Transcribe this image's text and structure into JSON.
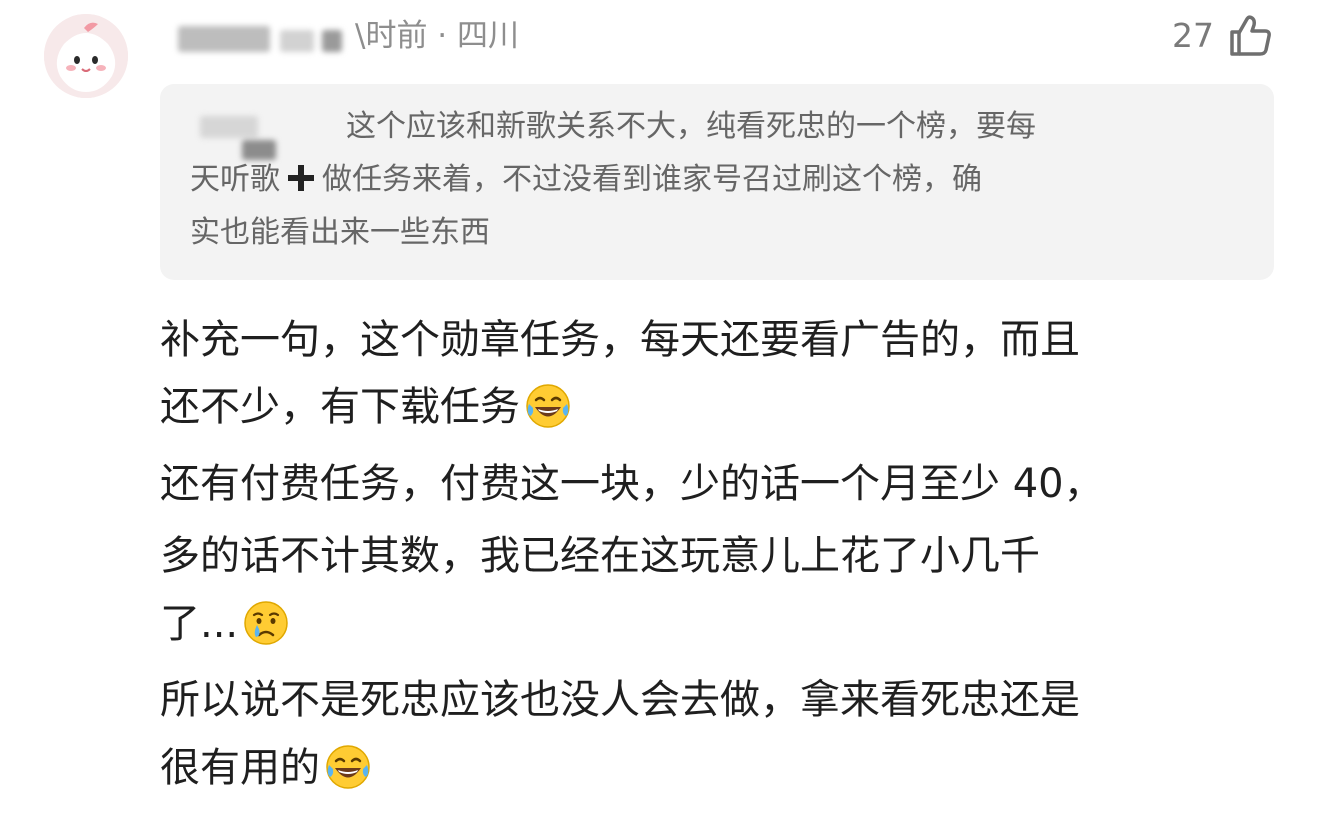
{
  "comment": {
    "meta_suffix": "\\时前 · 四川",
    "likes": "27",
    "quote": {
      "line1": "这个应该和新歌关系不大，纯看死忠的一个榜，要每",
      "line2_prefix": "天听歌",
      "line2_suffix": "做任务来着，不过没看到谁家号召过刷这个榜，确",
      "line3": "实也能看出来一些东西"
    },
    "body": {
      "line1": "补充一句，这个勋章任务，每天还要看广告的，而且",
      "line2": "还不少，有下载任务",
      "line3": "还有付费任务，付费这一块，少的话一个月至少 40，",
      "line4": "多的话不计其数，我已经在这玩意儿上花了小几千",
      "line5": "了...",
      "line6": "所以说不是死忠应该也没人会去做，拿来看死忠还是",
      "line7": "很有用的"
    }
  },
  "icons": {
    "avatar": "pink-blob-avatar",
    "like": "thumbs-up-icon",
    "plus": "plus-icon",
    "laugh": "tears-of-joy-emoji",
    "cry": "crying-face-emoji"
  },
  "colors": {
    "meta": "#8e8e8e",
    "quote_bg": "#f3f3f3",
    "quote_text": "#666666",
    "body_text": "#1f1f1f",
    "avatar_bg": "#f7e9ea"
  }
}
